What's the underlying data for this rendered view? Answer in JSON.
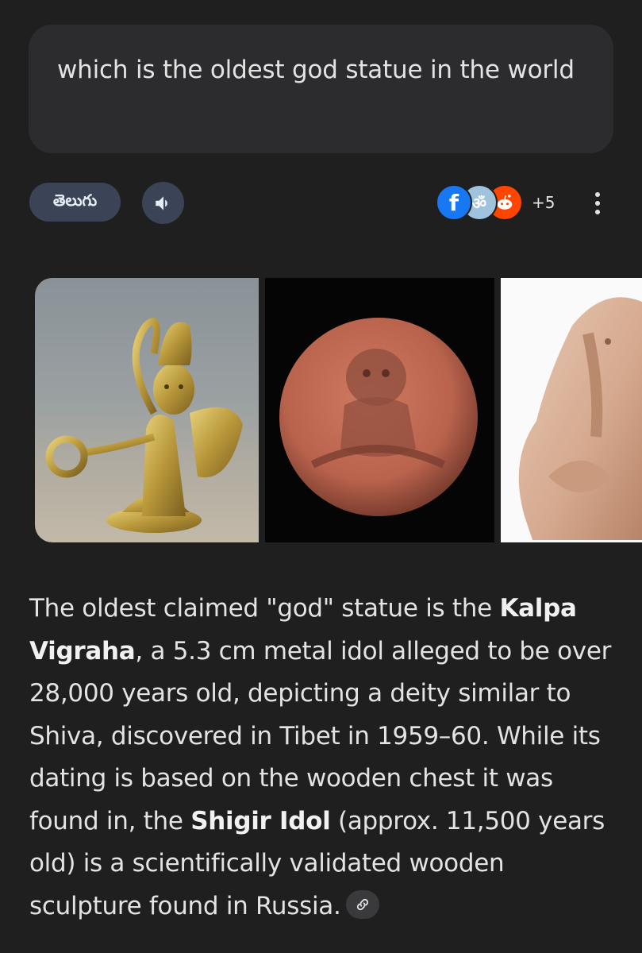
{
  "query": {
    "text": "which is the oldest god statue in the world"
  },
  "toolbar": {
    "language_label": "తెలుగు",
    "speaker_icon": "speaker-icon",
    "sources": {
      "icons": [
        "facebook-icon",
        "om-icon",
        "reddit-icon"
      ],
      "extra_count": "+5"
    },
    "more_icon": "more-vert-icon"
  },
  "images": [
    {
      "icon": "golden-idol-image"
    },
    {
      "icon": "round-clay-seal-image"
    },
    {
      "icon": "clay-ganesha-figure-image"
    }
  ],
  "answer": {
    "p1": "The oldest claimed \"god\" statue is the ",
    "b1": "Kalpa Vigraha",
    "p2": ", a 5.3 cm metal idol alleged to be over 28,000 years old, depicting a deity similar to Shiva, discovered in Tibet in 1959–60. While its dating is based on the wooden chest it was found in, the ",
    "b2": "Shigir Idol",
    "p3": " (approx. 11,500 years old) is a scientifically validated wooden sculpture found in Russia.",
    "link_icon": "link-icon"
  },
  "colors": {
    "background": "#1f1f1f",
    "bubble": "#2c2c2f",
    "chip": "#3b4456",
    "text": "#e3e3e3"
  }
}
